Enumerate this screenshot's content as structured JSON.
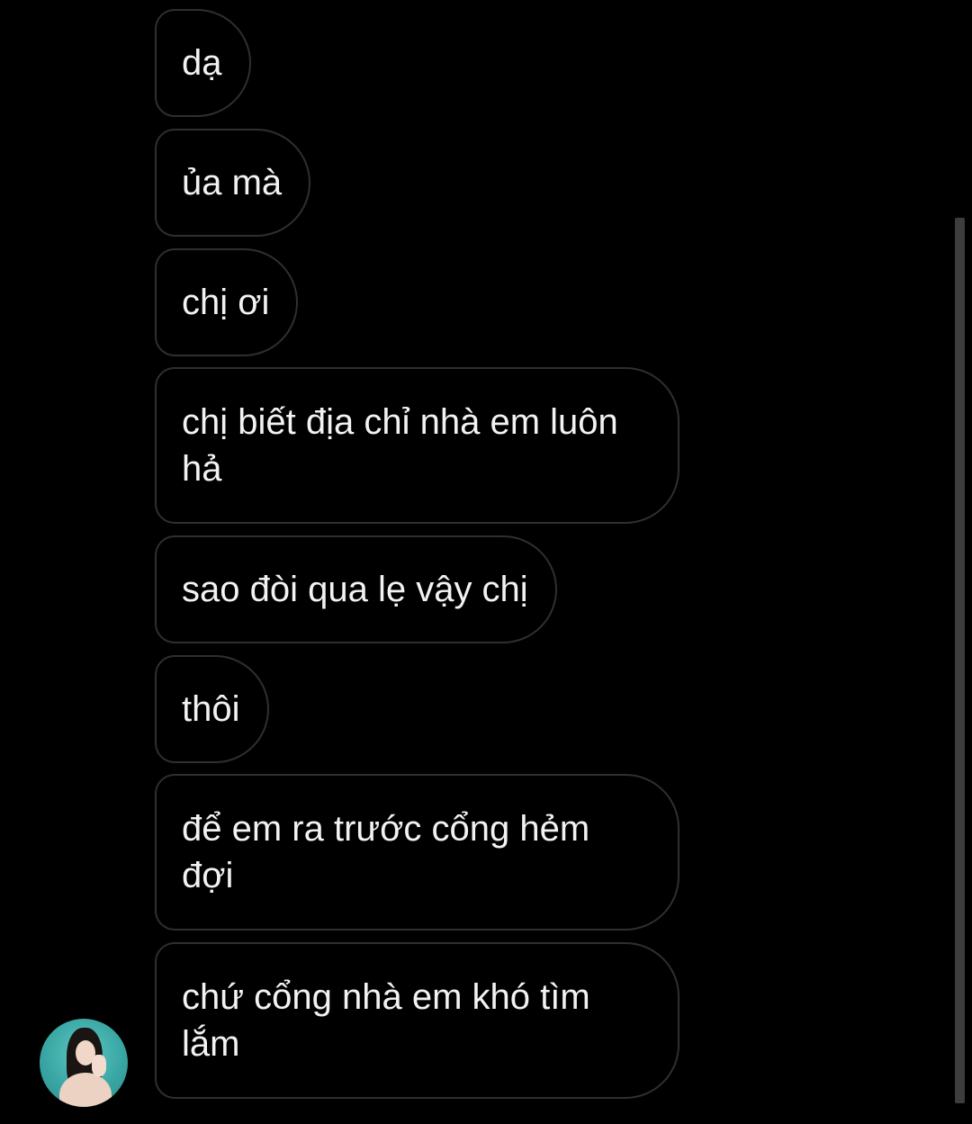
{
  "messages": [
    "dạ",
    "ủa mà",
    "chị ơi",
    "chị biết địa chỉ nhà em luôn hả",
    "sao đòi qua lẹ vậy chị",
    "thôi",
    "để em ra trước cổng hẻm đợi",
    "chứ cổng nhà em khó tìm lắm"
  ],
  "colors": {
    "background": "#000000",
    "bubble_border": "#2f2f2f",
    "text": "#f2f2f2",
    "scrollbar": "#3d3d3d"
  },
  "icons": {
    "avatar": "profile-photo"
  }
}
